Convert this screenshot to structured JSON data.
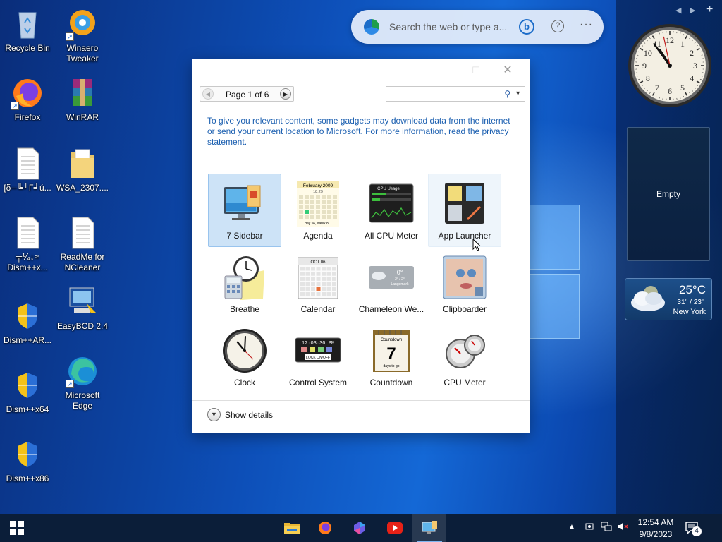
{
  "desktop": {
    "icons": [
      {
        "label": "Recycle Bin",
        "icon": "recycle-bin-icon"
      },
      {
        "label": "Winaero Tweaker",
        "icon": "winaero-tweaker-icon"
      },
      {
        "label": "Firefox",
        "icon": "firefox-icon"
      },
      {
        "label": "WinRAR",
        "icon": "winrar-icon"
      },
      {
        "label": "[δ─╚┘Γ╛ú...",
        "icon": "text-file-icon"
      },
      {
        "label": "WSA_2307....",
        "icon": "folder-icon"
      },
      {
        "label": "╤⅟₄↓≈ Dism++x...",
        "icon": "text-file-icon"
      },
      {
        "label": "ReadMe for NCleaner",
        "icon": "text-file-icon"
      },
      {
        "label": "Dism++AR...",
        "icon": "shield-icon"
      },
      {
        "label": "EasyBCD 2.4",
        "icon": "easybcd-icon"
      },
      {
        "label": "Dism++x64",
        "icon": "shield-icon"
      },
      {
        "label": "Microsoft Edge",
        "icon": "edge-icon"
      },
      {
        "label": "Dism++x86",
        "icon": "shield-icon"
      }
    ]
  },
  "search": {
    "placeholder": "Search the web or type a..."
  },
  "sidebar": {
    "empty_label": "Empty",
    "clock": {
      "hour": 10,
      "minute": 54,
      "second": 58,
      "numbers": [
        "12",
        "1",
        "2",
        "3",
        "4",
        "5",
        "6",
        "7",
        "8",
        "9",
        "10",
        "11"
      ]
    },
    "weather": {
      "temp": "25°C",
      "range": "31° / 23°",
      "city": "New York"
    }
  },
  "gadget_window": {
    "page_label": "Page 1 of 6",
    "notice": "To give you relevant content, some gadgets may download data from the internet or send your current location to Microsoft. For more information, read the privacy statement.",
    "gadgets": [
      {
        "label": "7 Sidebar",
        "icon": "sidebar-gadget-icon",
        "state": "selected"
      },
      {
        "label": "Agenda",
        "icon": "agenda-gadget-icon",
        "calendar_month": "February 2009",
        "calendar_time": "18:29",
        "calendar_footer": "day 56, week 8"
      },
      {
        "label": "All CPU Meter",
        "icon": "cpu-meter-gadget-icon",
        "screen_title": "CPU Usage"
      },
      {
        "label": "App Launcher",
        "icon": "app-launcher-gadget-icon",
        "state": "hover"
      },
      {
        "label": "Breathe",
        "icon": "breathe-gadget-icon"
      },
      {
        "label": "Calendar",
        "icon": "calendar-gadget-icon",
        "month": "OCT 06"
      },
      {
        "label": "Chameleon We...",
        "icon": "chameleon-weather-gadget-icon",
        "temp": "0°",
        "range": "2° / 2°",
        "location": "Langemark"
      },
      {
        "label": "Clipboarder",
        "icon": "clipboarder-gadget-icon"
      },
      {
        "label": "Clock",
        "icon": "clock-gadget-icon"
      },
      {
        "label": "Control System",
        "icon": "control-system-gadget-icon",
        "display_time": "12:03:30 PM",
        "lock_text": "LOCK ON/OFF"
      },
      {
        "label": "Countdown",
        "icon": "countdown-gadget-icon",
        "title": "Countdown",
        "number": "7",
        "footer": "days to go"
      },
      {
        "label": "CPU Meter",
        "icon": "cpu-gauge-gadget-icon"
      }
    ],
    "show_details": "Show details"
  },
  "taskbar": {
    "apps": [
      "start-icon",
      "file-explorer-icon",
      "firefox-icon",
      "copilot-icon",
      "youtube-icon",
      "gadgets-icon"
    ],
    "time": "12:54 AM",
    "date": "9/8/2023",
    "notification_count": "4"
  },
  "colors": {
    "accent": "#1b5fb0",
    "selection": "#cde3f7",
    "taskbar": "#0b1e39"
  }
}
